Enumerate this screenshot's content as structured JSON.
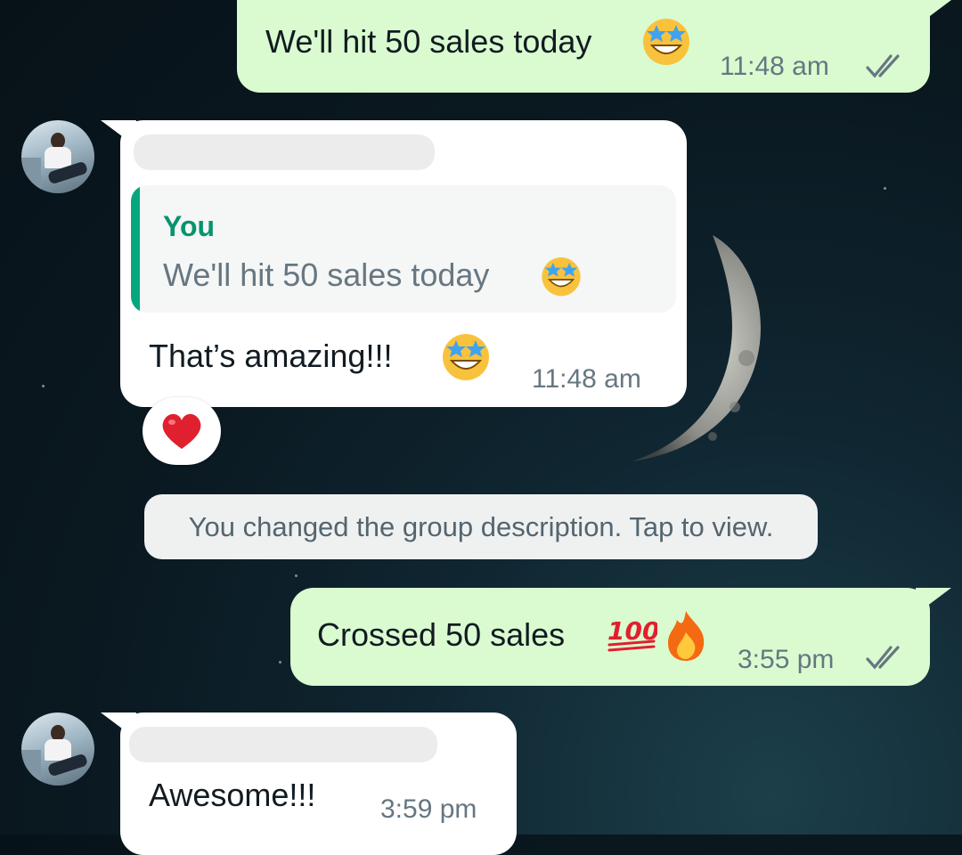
{
  "messages": [
    {
      "text": "We'll hit 50 sales today",
      "emoji": "star-struck-icon",
      "time": "11:48 am",
      "status": "read"
    },
    {
      "reply_author": "You",
      "reply_text": "We'll hit 50 sales today",
      "reply_emoji": "star-struck-icon",
      "text": "That’s amazing!!!",
      "emoji": "star-struck-icon",
      "time": "11:48 am",
      "reaction": "heart-icon"
    },
    {
      "text": "You changed the group description. Tap to view."
    },
    {
      "text": "Crossed 50 sales",
      "emojis": [
        "hundred-points-icon",
        "fire-icon"
      ],
      "time": "3:55 pm",
      "status": "read"
    },
    {
      "text": "Awesome!!!",
      "time": "3:59 pm"
    }
  ],
  "colors": {
    "outgoing_bubble": "#dafbd0",
    "incoming_bubble": "#ffffff",
    "reply_accent": "#06a77d",
    "read_ticks": "#667781"
  }
}
